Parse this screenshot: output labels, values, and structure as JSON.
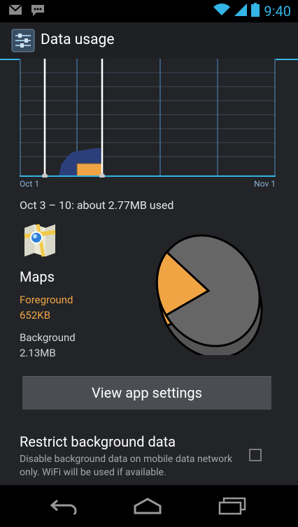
{
  "status_bar": {
    "time": "9:40",
    "icons": [
      "gmail-icon",
      "chat-icon",
      "wifi-icon",
      "signal-icon",
      "battery-icon"
    ]
  },
  "action_bar": {
    "title": "Data usage",
    "icon": "data-usage-settings-icon"
  },
  "chart": {
    "start_label": "Oct 1",
    "end_label": "Nov 1"
  },
  "summary": {
    "text": "Oct 3 – 10: about 2.77MB used"
  },
  "app": {
    "name": "Maps",
    "icon": "maps-app-icon",
    "foreground_label": "Foreground",
    "foreground_value": "652KB",
    "background_label": "Background",
    "background_value": "2.13MB"
  },
  "colors": {
    "accent": "#33b5e5",
    "foreground": "#f0a444",
    "background_gray": "#666666",
    "chart_fill": "#2b3f7a"
  },
  "buttons": {
    "view_app_settings": "View app settings"
  },
  "setting": {
    "title": "Restrict background data",
    "description": "Disable background data on mobile data network only. WiFi will be used if available.",
    "checked": false
  },
  "nav": {
    "icons": [
      "back-icon",
      "home-icon",
      "recent-apps-icon"
    ]
  }
}
